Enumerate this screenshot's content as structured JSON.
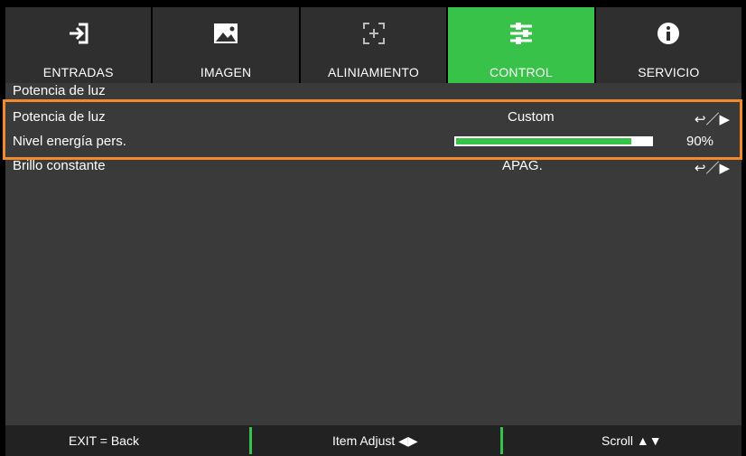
{
  "tabs": [
    {
      "label": "ENTRADAS",
      "icon": "input-icon"
    },
    {
      "label": "IMAGEN",
      "icon": "image-icon"
    },
    {
      "label": "ALINIAMIENTO",
      "icon": "alignment-icon"
    },
    {
      "label": "CONTROL",
      "icon": "sliders-icon",
      "active": true
    },
    {
      "label": "SERVICIO",
      "icon": "info-icon"
    }
  ],
  "section_title": "Potencia de luz",
  "rows": [
    {
      "label": "Potencia de luz",
      "value": "Custom",
      "action": "↩／▶"
    },
    {
      "label": "Nivel energía pers.",
      "value": "",
      "progress": 0.9,
      "percent": "90%"
    },
    {
      "label": "Brillo constante",
      "value": "APAG.",
      "action": "↩／▶"
    }
  ],
  "footer": {
    "exit": "EXIT = Back",
    "adjust": "Item Adjust ◀▶",
    "scroll": "Scroll ▲▼"
  },
  "colors": {
    "accent": "#39c24a",
    "highlight": "#f08a2c",
    "panel": "#3a3a3a"
  }
}
